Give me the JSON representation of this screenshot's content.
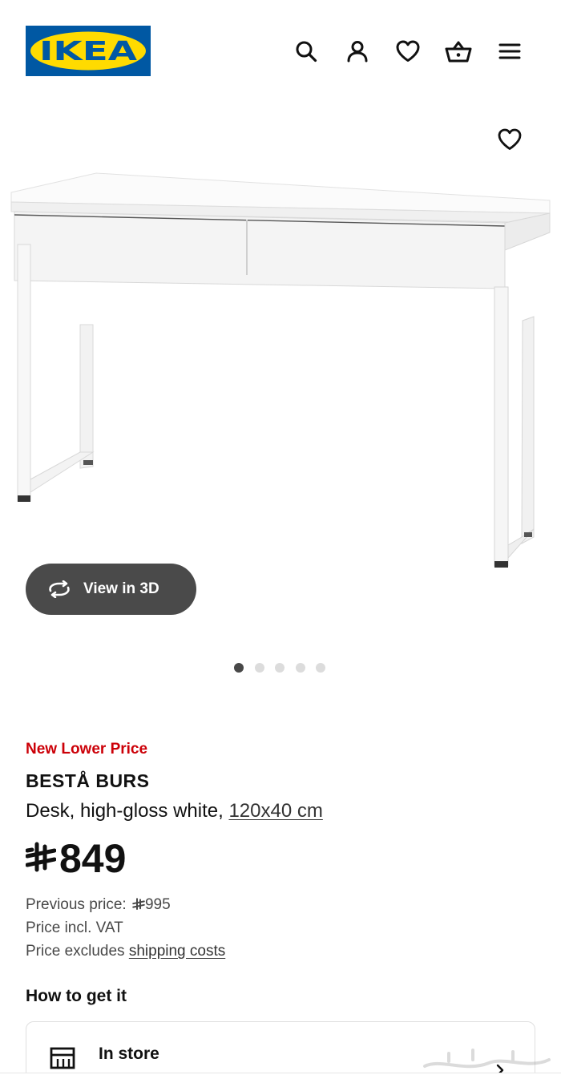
{
  "header": {
    "logo_text": "IKEA",
    "icons": [
      "search-icon",
      "account-icon",
      "favourites-icon",
      "cart-icon",
      "menu-icon"
    ]
  },
  "gallery": {
    "favourite_icon": "heart-icon",
    "view3d_label": "View in 3D",
    "image_count": 5,
    "active_image": 1
  },
  "product": {
    "badge": "New Lower Price",
    "name": "BESTÅ BURS",
    "description": "Desk, high-gloss white,",
    "size": "120x40 cm",
    "currency_icon": "saudi-riyal-icon",
    "price": "849",
    "previous_price_label": "Previous price:",
    "previous_price": "995",
    "vat_note": "Price incl. VAT",
    "shipping_prefix": "Price excludes",
    "shipping_link": "shipping costs"
  },
  "fulfilment": {
    "heading": "How to get it",
    "store_label": "In store"
  },
  "colors": {
    "ikea_blue": "#0058a3",
    "ikea_yellow": "#ffdb00",
    "badge_red": "#cc0008",
    "pill_grey": "#4a4a4a"
  }
}
